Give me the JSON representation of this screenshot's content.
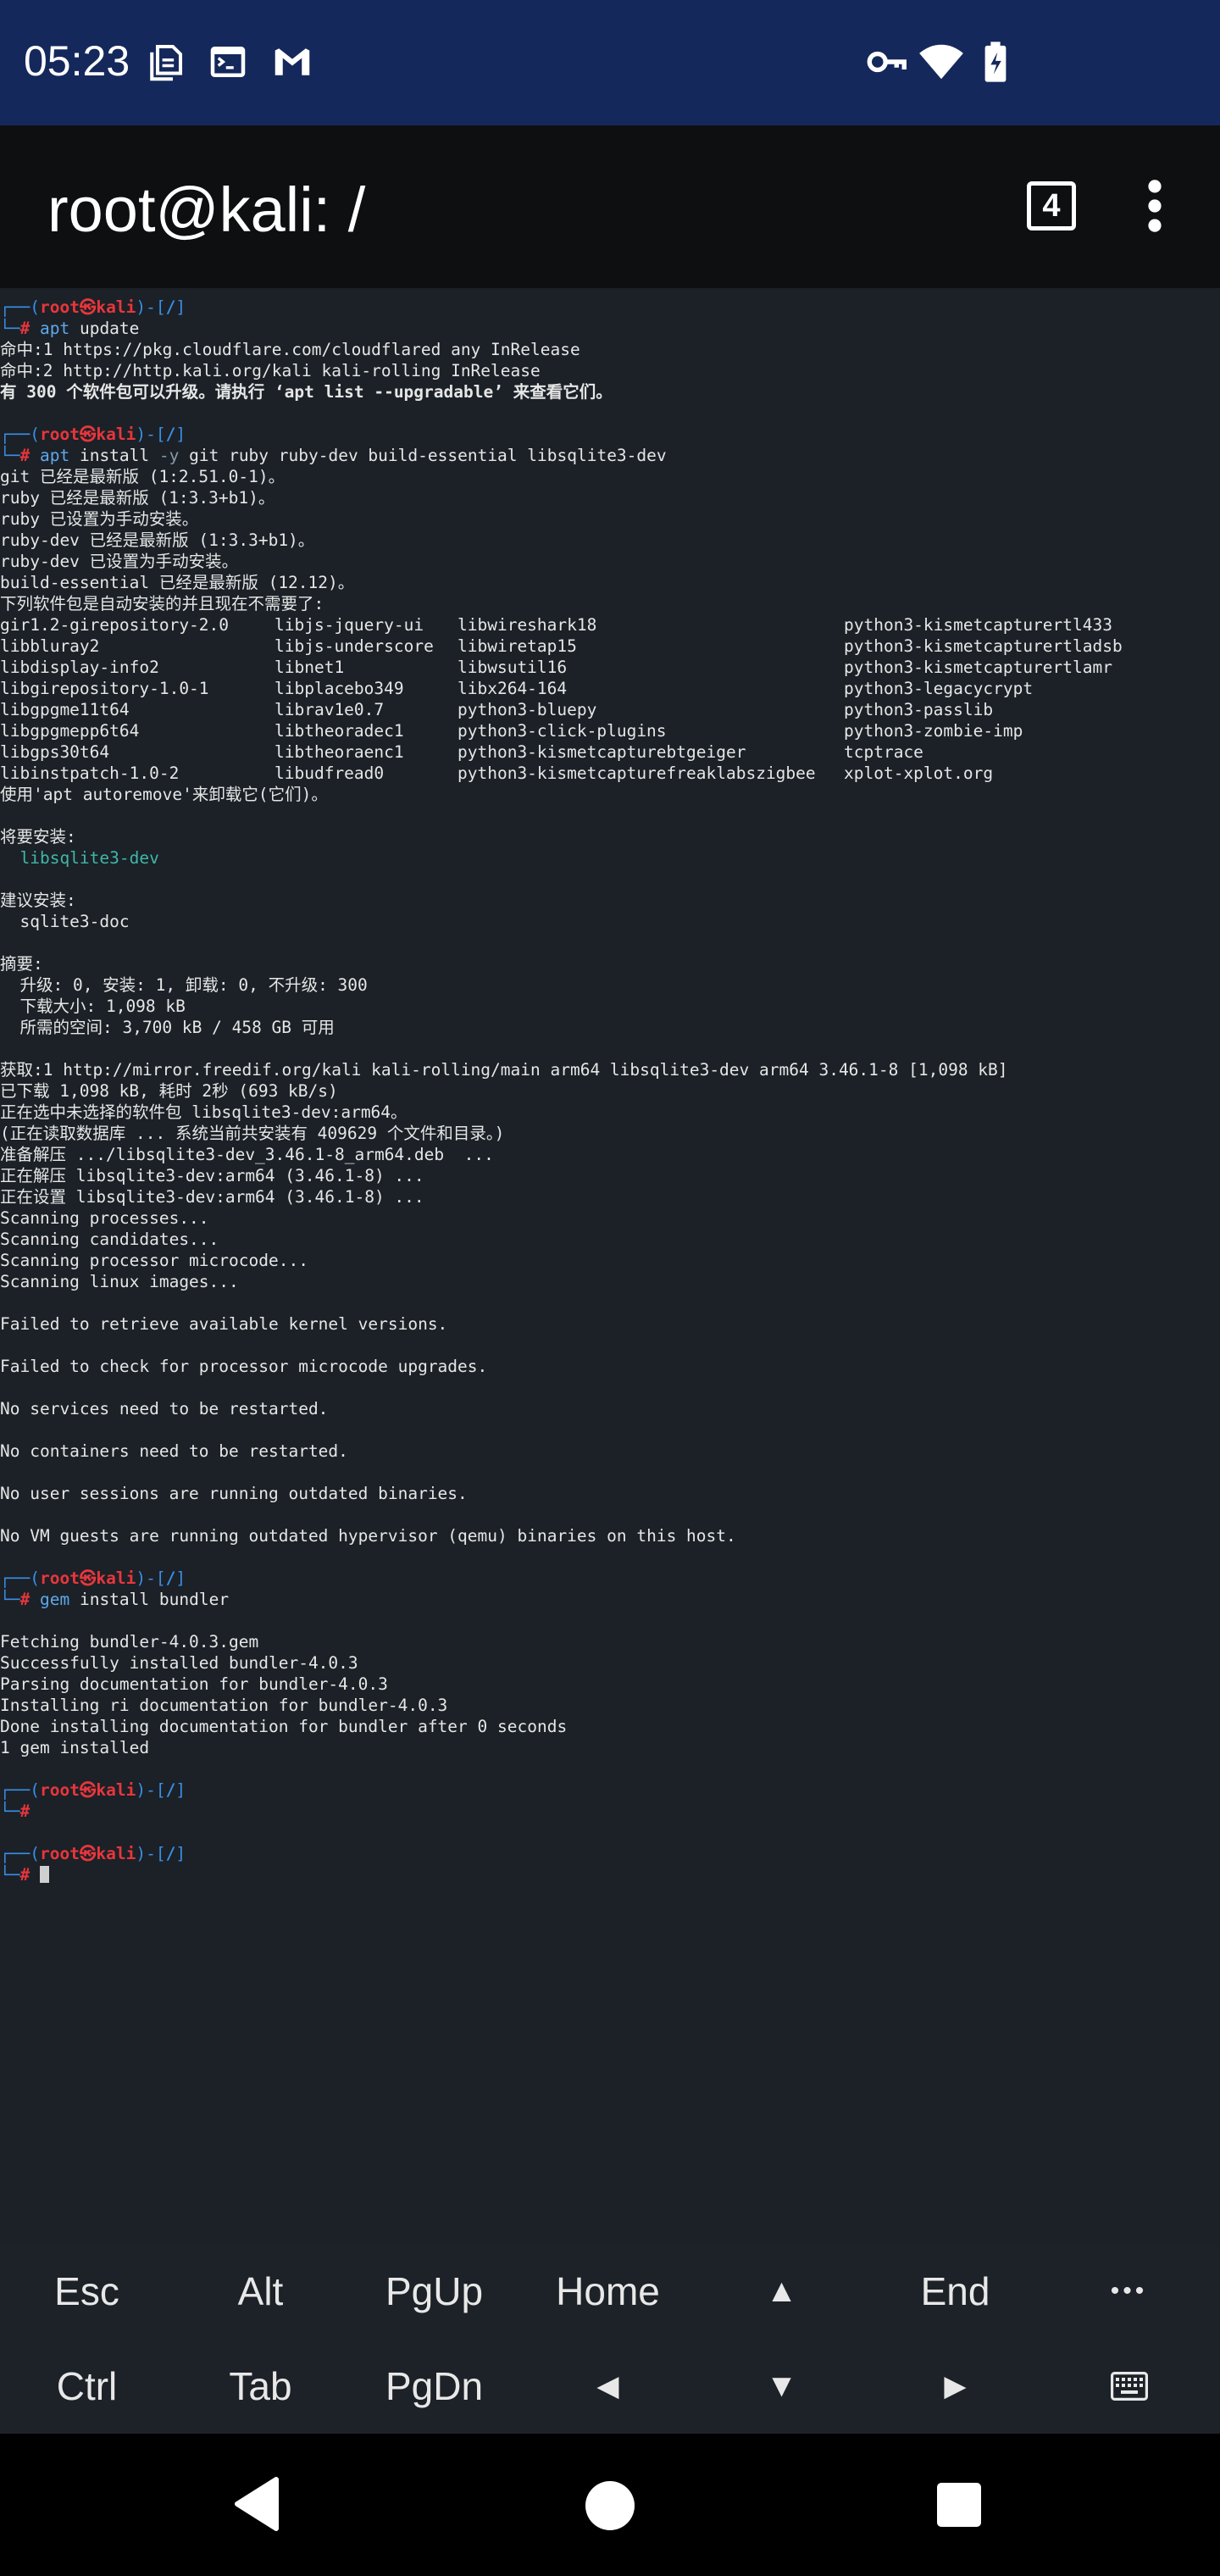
{
  "status_bar": {
    "time": "05:23",
    "icons": [
      "document-icon",
      "terminal-icon",
      "gmail-icon",
      "vpn-key-icon",
      "wifi-icon",
      "battery-charging-icon"
    ]
  },
  "app_bar": {
    "title": "root@kali: /",
    "tabs_count": "4",
    "menu_icon": "more-vert-icon"
  },
  "terminal": {
    "prompt": {
      "corner_top": "┌──(",
      "user": "root㉿kali",
      "mid": ")-[",
      "path": "/",
      "end": "]",
      "corner_bottom": "└─",
      "hash": "#"
    },
    "cmd1": {
      "name": "apt",
      "args": " update"
    },
    "cmd1_output": [
      "命中:1 https://pkg.cloudflare.com/cloudflared any InRelease",
      "命中:2 http://http.kali.org/kali kali-rolling InRelease"
    ],
    "cmd1_bold": "有 300 个软件包可以升级。请执行 ‘apt list --upgradable’ 来查看它们。",
    "cmd2": {
      "name": "apt",
      "args_a": " install ",
      "flag": "-y",
      "args_b": " git ruby ruby-dev build-essential libsqlite3-dev"
    },
    "cmd2_output_a": [
      "git 已经是最新版 (1:2.51.0-1)。",
      "ruby 已经是最新版 (1:3.3+b1)。",
      "ruby 已设置为手动安装。",
      "ruby-dev 已经是最新版 (1:3.3+b1)。",
      "ruby-dev 已设置为手动安装。",
      "build-essential 已经是最新版 (12.12)。",
      "下列软件包是自动安装的并且现在不需要了:"
    ],
    "autoremove_cols": [
      [
        "gir1.2-girepository-2.0",
        "libjs-jquery-ui",
        "libwireshark18",
        "python3-kismetcapturertl433"
      ],
      [
        "libbluray2",
        "libjs-underscore",
        "libwiretap15",
        "python3-kismetcapturertladsb"
      ],
      [
        "libdisplay-info2",
        "libnet1",
        "libwsutil16",
        "python3-kismetcapturertlamr"
      ],
      [
        "libgirepository-1.0-1",
        "libplacebo349",
        "libx264-164",
        "python3-legacycrypt"
      ],
      [
        "libgpgme11t64",
        "librav1e0.7",
        "python3-bluepy",
        "python3-passlib"
      ],
      [
        "libgpgmepp6t64",
        "libtheoradec1",
        "python3-click-plugins",
        "python3-zombie-imp"
      ],
      [
        "libgps30t64",
        "libtheoraenc1",
        "python3-kismetcapturebtgeiger",
        "tcptrace"
      ],
      [
        "libinstpatch-1.0-2",
        "libudfread0",
        "python3-kismetcapturefreaklabszigbee",
        "xplot-xplot.org"
      ]
    ],
    "autoremove_hint": "使用'apt autoremove'来卸载它(它们)。",
    "will_install_label": "将要安装:",
    "will_install_pkg": "  libsqlite3-dev",
    "suggested_label": "建议安装:",
    "suggested_pkg": "  sqlite3-doc",
    "summary_label": "摘要:",
    "summary_lines": [
      "  升级: 0, 安装: 1, 卸载: 0, 不升级: 300",
      "  下载大小: 1,098 kB",
      "  所需的空间: 3,700 kB / 458 GB 可用"
    ],
    "fetch_lines": [
      "获取:1 http://mirror.freedif.org/kali kali-rolling/main arm64 libsqlite3-dev arm64 3.46.1-8 [1,098 kB]",
      "已下载 1,098 kB, 耗时 2秒 (693 kB/s)",
      "正在选中未选择的软件包 libsqlite3-dev:arm64。",
      "(正在读取数据库 ... 系统当前共安装有 409629 个文件和目录。)",
      "准备解压 .../libsqlite3-dev_3.46.1-8_arm64.deb  ...",
      "正在解压 libsqlite3-dev:arm64 (3.46.1-8) ...",
      "正在设置 libsqlite3-dev:arm64 (3.46.1-8) ...",
      "Scanning processes...",
      "Scanning candidates...",
      "Scanning processor microcode...",
      "Scanning linux images..."
    ],
    "msg_kernel": "Failed to retrieve available kernel versions.",
    "msg_microcode": "Failed to check for processor microcode upgrades.",
    "msg_services": "No services need to be restarted.",
    "msg_containers": "No containers need to be restarted.",
    "msg_sessions": "No user sessions are running outdated binaries.",
    "msg_vm": "No VM guests are running outdated hypervisor (qemu) binaries on this host.",
    "cmd3": {
      "name": "gem",
      "args": " install bundler"
    },
    "cmd3_output": [
      "Fetching bundler-4.0.3.gem",
      "Successfully installed bundler-4.0.3",
      "Parsing documentation for bundler-4.0.3",
      "Installing ri documentation for bundler-4.0.3",
      "Done installing documentation for bundler after 0 seconds",
      "1 gem installed"
    ]
  },
  "extra_keys": {
    "row1": [
      "Esc",
      "Alt",
      "PgUp",
      "Home",
      "▲",
      "End",
      "•••"
    ],
    "row2": [
      "Ctrl",
      "Tab",
      "PgDn",
      "◀",
      "▼",
      "▶",
      "keyboard-icon"
    ]
  },
  "nav_bar": {
    "icons": [
      "back-icon",
      "home-icon",
      "recents-icon"
    ]
  }
}
